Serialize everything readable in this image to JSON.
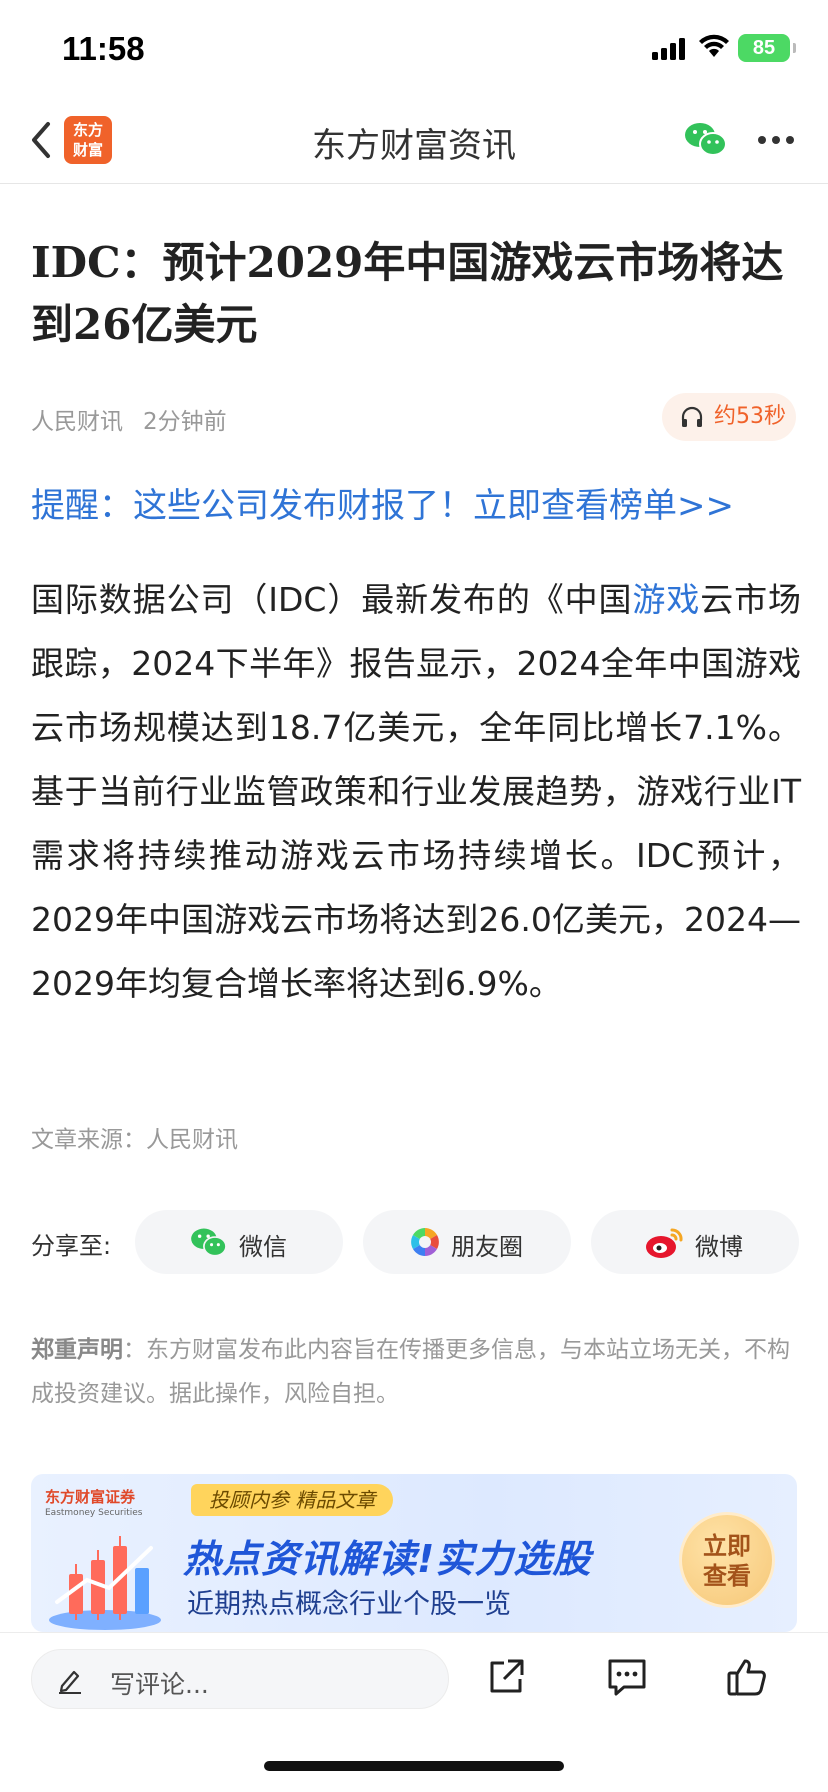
{
  "status_bar": {
    "time": "11:58",
    "battery": "85"
  },
  "nav": {
    "title": "东方财富资讯",
    "logo_text_1": "东方",
    "logo_text_2": "财富"
  },
  "article": {
    "title": "IDC：预计2029年中国游戏云市场将达到26亿美元",
    "source_name": "人民财讯",
    "time_ago": "2分钟前",
    "audio_duration": "约53秒",
    "reminder": "提醒：这些公司发布财报了！立即查看榜单>>",
    "body_before": "国际数据公司（IDC）最新发布的《中国",
    "body_keyword": "游戏",
    "body_after": "云市场跟踪，2024下半年》报告显示，2024全年中国游戏云市场规模达到18.7亿美元，全年同比增长7.1%。基于当前行业监管政策和行业发展趋势，游戏行业IT需求将持续推动游戏云市场持续增长。IDC预计，2029年中国游戏云市场将达到26.0亿美元，2024—2029年均复合增长率将达到6.9%。",
    "source_line": "文章来源：人民财讯"
  },
  "share": {
    "label": "分享至:",
    "wechat": "微信",
    "moments": "朋友圈",
    "weibo": "微博"
  },
  "disclaimer": {
    "title": "郑重声明",
    "text": "：东方财富发布此内容旨在传播更多信息，与本站立场无关，不构成投资建议。据此操作，风险自担。"
  },
  "banner": {
    "brand": "东方财富证券",
    "brand_en": "Eastmoney Securities",
    "tag": "投顾内参 精品文章",
    "headline": "热点资讯解读!实力选股",
    "sub": "近期热点概念行业个股一览",
    "cta_1": "立即",
    "cta_2": "查看"
  },
  "bottom_bar": {
    "comment_placeholder": "写评论..."
  },
  "colors": {
    "accent_blue": "#2f74d6",
    "brand_orange": "#f0622a",
    "battery_green": "#4cd964"
  },
  "icons": [
    "back-icon",
    "wechat-icon",
    "more-icon",
    "headphones-icon",
    "moments-icon",
    "weibo-icon",
    "pencil-icon",
    "share-out-icon",
    "comment-icon",
    "thumbs-up-icon"
  ]
}
